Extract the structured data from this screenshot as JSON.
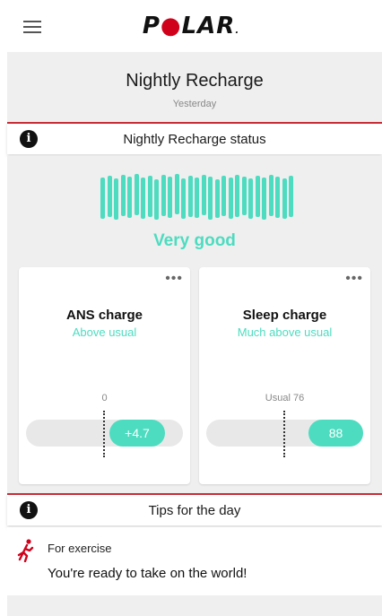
{
  "app": {
    "logo_text": "POLAR",
    "accent_color": "#d0021b",
    "teal_color": "#4ddcc0"
  },
  "header": {
    "title": "Nightly Recharge",
    "subtitle": "Yesterday"
  },
  "status_section": {
    "info_icon": "i",
    "label": "Nightly Recharge status",
    "status_text": "Very good"
  },
  "cards": {
    "ans": {
      "title": "ANS charge",
      "subtitle": "Above usual",
      "usual_label": "0",
      "value": "+4.7",
      "more": "•••"
    },
    "sleep": {
      "title": "Sleep charge",
      "subtitle": "Much above usual",
      "usual_label": "Usual 76",
      "value": "88",
      "more": "•••"
    }
  },
  "tips_section": {
    "info_icon": "i",
    "label": "Tips for the day",
    "category": "For exercise",
    "text": "You're ready to take on the world!"
  }
}
